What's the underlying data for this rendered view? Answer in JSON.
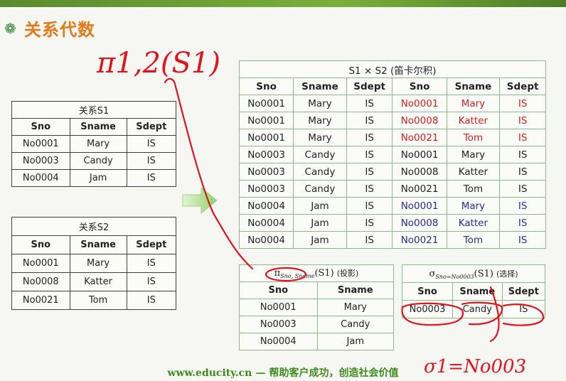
{
  "page": {
    "title": "关系代数",
    "footer_site": "www.educity.cn",
    "footer_dash": "—",
    "footer_slogan": "帮助客户成功，创造社会价值"
  },
  "s1": {
    "caption": "关系S1",
    "headers": [
      "Sno",
      "Sname",
      "Sdept"
    ],
    "rows": [
      [
        "No0001",
        "Mary",
        "IS"
      ],
      [
        "No0003",
        "Candy",
        "IS"
      ],
      [
        "No0004",
        "Jam",
        "IS"
      ]
    ]
  },
  "s2": {
    "caption": "关系S2",
    "headers": [
      "Sno",
      "Sname",
      "Sdept"
    ],
    "rows": [
      [
        "No0001",
        "Mary",
        "IS"
      ],
      [
        "No0008",
        "Katter",
        "IS"
      ],
      [
        "No0021",
        "Tom",
        "IS"
      ]
    ]
  },
  "product": {
    "caption": "S1 × S2 (笛卡尔积)",
    "headers": [
      "Sno",
      "Sname",
      "Sdept",
      "Sno",
      "Sname",
      "Sdept"
    ],
    "rows": [
      [
        "No0001",
        "Mary",
        "IS",
        "No0001",
        "Mary",
        "IS"
      ],
      [
        "No0001",
        "Mary",
        "IS",
        "No0008",
        "Katter",
        "IS"
      ],
      [
        "No0001",
        "Mary",
        "IS",
        "No0021",
        "Tom",
        "IS"
      ],
      [
        "No0003",
        "Candy",
        "IS",
        "No0001",
        "Mary",
        "IS"
      ],
      [
        "No0003",
        "Candy",
        "IS",
        "No0008",
        "Katter",
        "IS"
      ],
      [
        "No0003",
        "Candy",
        "IS",
        "No0021",
        "Tom",
        "IS"
      ],
      [
        "No0004",
        "Jam",
        "IS",
        "No0001",
        "Mary",
        "IS"
      ],
      [
        "No0004",
        "Jam",
        "IS",
        "No0008",
        "Katter",
        "IS"
      ],
      [
        "No0004",
        "Jam",
        "IS",
        "No0021",
        "Tom",
        "IS"
      ]
    ],
    "row_colors": [
      "red",
      "red",
      "red",
      "",
      "",
      "",
      "blue",
      "blue",
      "blue"
    ]
  },
  "projection": {
    "symbol": "π",
    "subscript": "Sno, Sname",
    "arg": "(S1)",
    "note": "(投影)",
    "headers": [
      "Sno",
      "Sname"
    ],
    "rows": [
      [
        "No0001",
        "Mary"
      ],
      [
        "No0003",
        "Candy"
      ],
      [
        "No0004",
        "Jam"
      ]
    ]
  },
  "selection": {
    "symbol": "σ",
    "subscript": "Sno=No0003",
    "arg": "(S1)",
    "note": "(选择)",
    "headers": [
      "Sno",
      "Sname",
      "Sdept"
    ],
    "rows": [
      [
        "No0003",
        "Candy",
        "IS"
      ]
    ]
  },
  "handwriting": {
    "pi_formula": "π1,2(S1)",
    "sigma_formula": "σ1=No003"
  },
  "colors": {
    "title": "#e07a1a",
    "footer": "#3d8a1f",
    "highlight_red": "#d81e1e",
    "highlight_blue": "#2a2a9a",
    "ink_red": "#e0141e"
  }
}
